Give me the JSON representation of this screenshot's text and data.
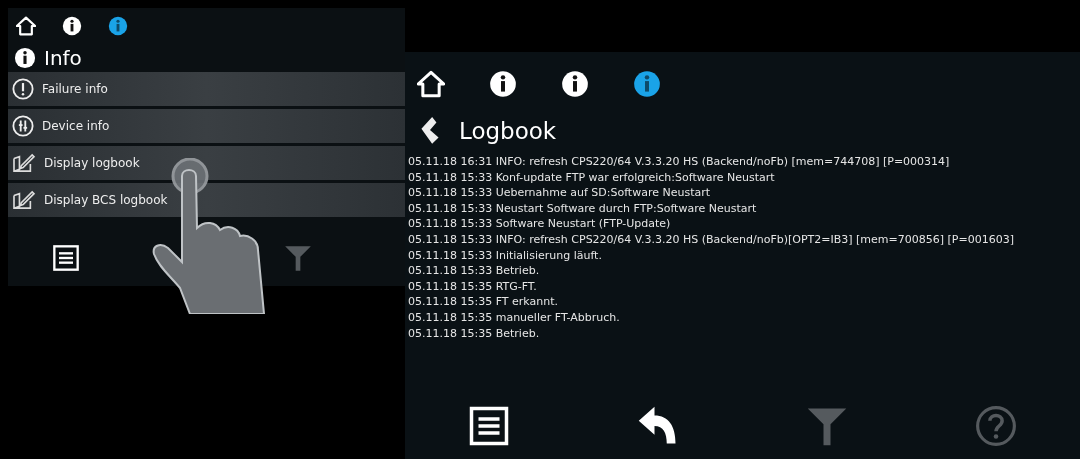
{
  "info_screen": {
    "breadcrumb": [
      {
        "kind": "home",
        "selected": false
      },
      {
        "kind": "info",
        "selected": false
      },
      {
        "kind": "info",
        "selected": true
      }
    ],
    "title": "Info",
    "items": [
      {
        "kind": "failure",
        "label": "Failure info"
      },
      {
        "kind": "device",
        "label": "Device info"
      },
      {
        "kind": "logbook",
        "label": "Display logbook"
      },
      {
        "kind": "logbook",
        "label": "Display BCS logbook"
      }
    ],
    "toolbar": [
      {
        "kind": "menu",
        "disabled": false
      },
      {
        "kind": "filter",
        "disabled": true
      }
    ]
  },
  "logbook_screen": {
    "breadcrumb": [
      {
        "kind": "home",
        "selected": false
      },
      {
        "kind": "info",
        "selected": false
      },
      {
        "kind": "info",
        "selected": false
      },
      {
        "kind": "info",
        "selected": true
      }
    ],
    "title": "Logbook",
    "lines": [
      "05.11.18 16:31 INFO: refresh CPS220/64 V.3.3.20 HS (Backend/noFb) [mem=744708] [P=000314]",
      "05.11.18 15:33 Konf-update FTP war erfolgreich:Software Neustart",
      "05.11.18 15:33 Uebernahme auf SD:Software Neustart",
      "05.11.18 15:33 Neustart Software durch FTP:Software Neustart",
      "05.11.18 15:33 Software Neustart (FTP-Update)",
      "05.11.18 15:33 INFO: refresh CPS220/64 V.3.3.20 HS (Backend/noFb)[OPT2=IB3] [mem=700856] [P=001603]",
      "05.11.18 15:33 Initialisierung läuft.",
      "05.11.18 15:33 Betrieb.",
      "05.11.18 15:35 RTG-FT.",
      "05.11.18 15:35 FT erkannt.",
      "05.11.18 15:35 manueller FT-Abbruch.",
      "05.11.18 15:35 Betrieb."
    ],
    "toolbar": [
      {
        "kind": "menu",
        "disabled": false
      },
      {
        "kind": "back",
        "disabled": false
      },
      {
        "kind": "filter",
        "disabled": true
      },
      {
        "kind": "help",
        "disabled": true
      }
    ]
  }
}
